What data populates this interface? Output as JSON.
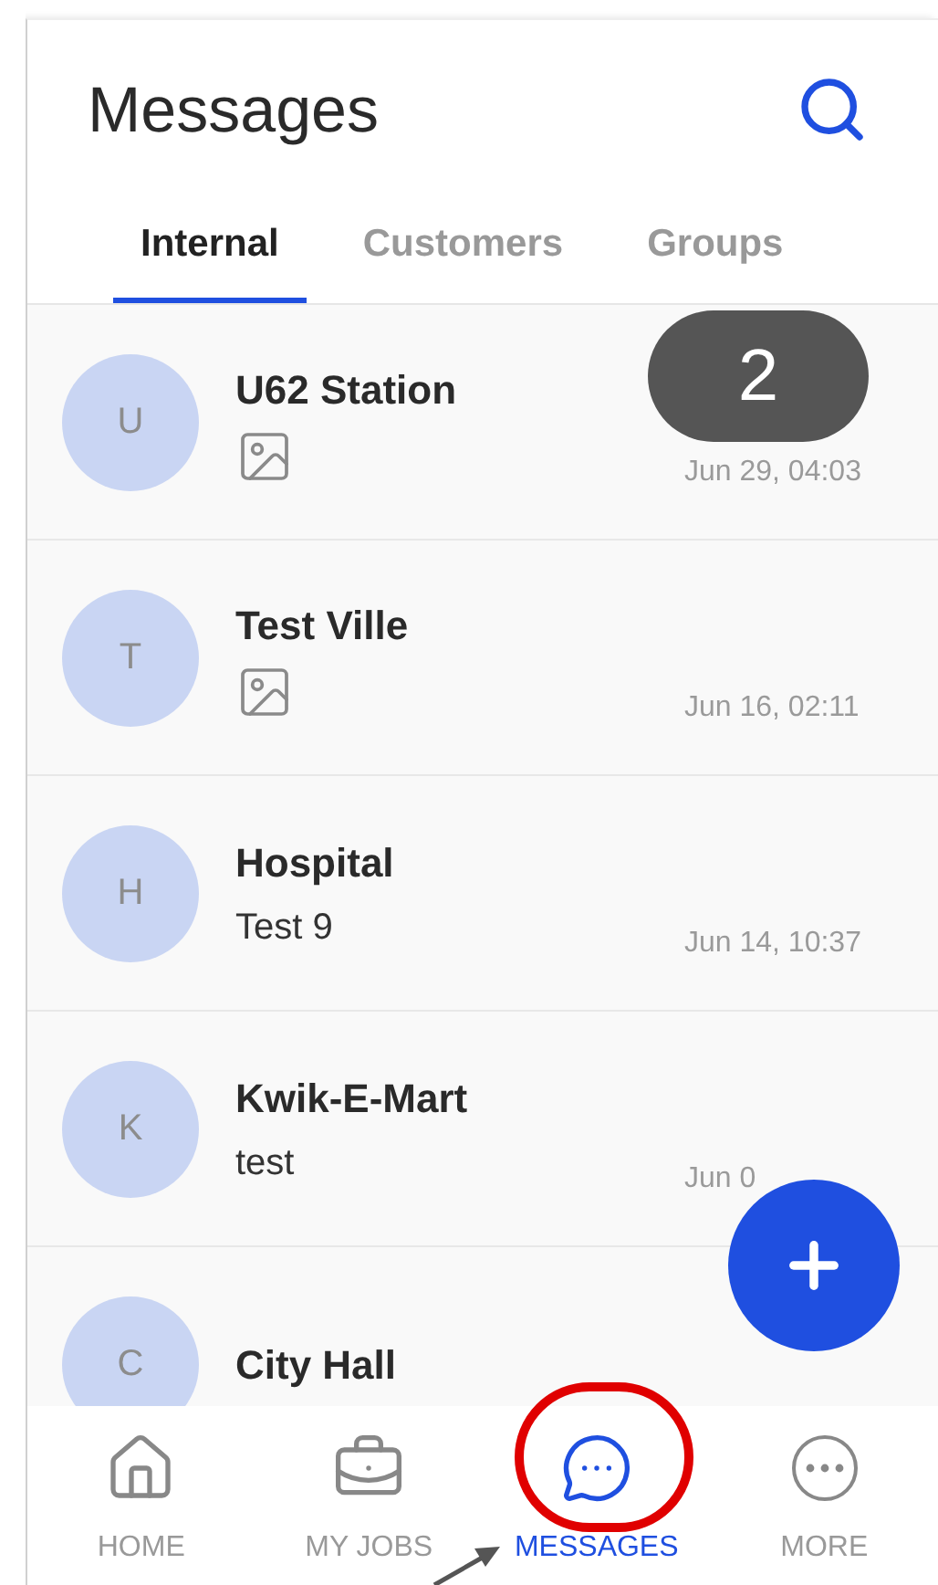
{
  "header": {
    "title": "Messages"
  },
  "tabs": [
    {
      "label": "Internal",
      "selected": true
    },
    {
      "label": "Customers",
      "selected": false
    },
    {
      "label": "Groups",
      "selected": false
    }
  ],
  "conversations": [
    {
      "avatar_letter": "U",
      "name": "U62 Station",
      "kind": "image",
      "time": "Jun 29, 04:03"
    },
    {
      "avatar_letter": "T",
      "name": "Test Ville",
      "kind": "image",
      "time": "Jun 16, 02:11"
    },
    {
      "avatar_letter": "H",
      "name": "Hospital",
      "kind": "text",
      "preview": "Test 9",
      "time": "Jun 14, 10:37"
    },
    {
      "avatar_letter": "K",
      "name": "Kwik-E-Mart",
      "kind": "text",
      "preview": "test",
      "time": "Jun 0"
    },
    {
      "avatar_letter": "C",
      "name": "City Hall"
    }
  ],
  "bottom_nav": [
    {
      "label": "HOME",
      "kind": "home",
      "selected": false,
      "circled": false
    },
    {
      "label": "MY JOBS",
      "kind": "jobs",
      "selected": false,
      "circled": false
    },
    {
      "label": "MESSAGES",
      "kind": "messages",
      "selected": true,
      "circled": true
    },
    {
      "label": "MORE",
      "kind": "more",
      "selected": false,
      "circled": false
    }
  ],
  "callout": {
    "number": "2"
  }
}
